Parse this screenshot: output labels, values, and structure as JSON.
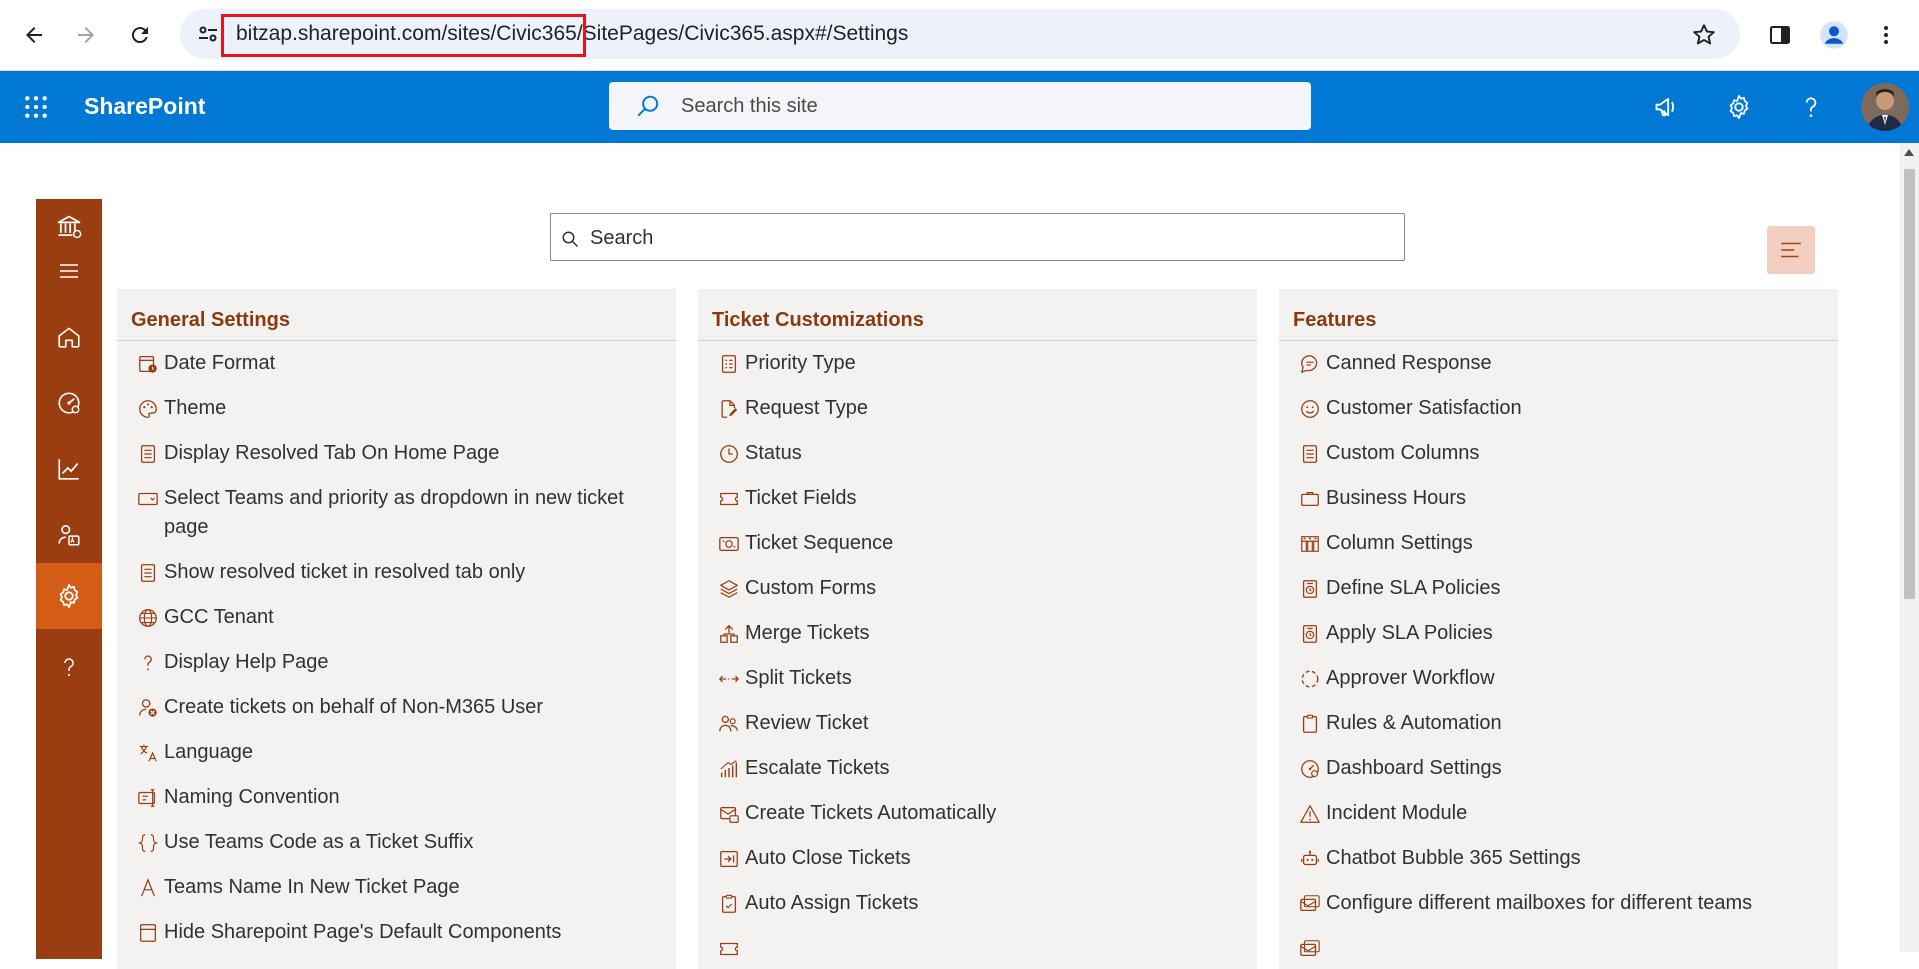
{
  "browser": {
    "url": "bitzap.sharepoint.com/sites/Civic365/SitePages/Civic365.aspx#/Settings"
  },
  "suitebar": {
    "brand": "SharePoint",
    "search_placeholder": "Search this site"
  },
  "main": {
    "search_placeholder": "Search"
  },
  "colors": {
    "accent": "#9a3d10",
    "accent_active": "#d35c17",
    "suitebar": "#0078d4",
    "section_title": "#8a3a0e"
  },
  "rail": {
    "items": [
      {
        "icon": "institution-icon"
      },
      {
        "icon": "hamburger-icon"
      },
      {
        "icon": "home-icon"
      },
      {
        "icon": "dashboard-gauge-icon"
      },
      {
        "icon": "reports-chart-icon"
      },
      {
        "icon": "users-admin-icon"
      },
      {
        "icon": "settings-gear-icon",
        "active": true
      },
      {
        "icon": "help-question-icon"
      }
    ]
  },
  "cards": [
    {
      "title": "General Settings",
      "items": [
        {
          "label": "Date Format",
          "icon": "calendar-clock-icon"
        },
        {
          "label": "Theme",
          "icon": "palette-icon"
        },
        {
          "label": "Display Resolved Tab On Home Page",
          "icon": "document-icon"
        },
        {
          "label": "Select Teams and priority as dropdown in new ticket page",
          "icon": "dropdown-box-icon"
        },
        {
          "label": "Show resolved ticket in resolved tab only",
          "icon": "document-icon"
        },
        {
          "label": "GCC Tenant",
          "icon": "globe-icon"
        },
        {
          "label": "Display Help Page",
          "icon": "question-icon"
        },
        {
          "label": "Create tickets on behalf of Non-M365 User",
          "icon": "user-remove-icon"
        },
        {
          "label": "Language",
          "icon": "translate-icon"
        },
        {
          "label": "Naming Convention",
          "icon": "rename-icon"
        },
        {
          "label": "Use Teams Code as a Ticket Suffix",
          "icon": "braces-icon"
        },
        {
          "label": "Teams Name In New Ticket Page",
          "icon": "text-a-icon"
        },
        {
          "label": "Hide Sharepoint Page's Default Components",
          "icon": "page-layout-icon"
        }
      ]
    },
    {
      "title": "Ticket Customizations",
      "items": [
        {
          "label": "Priority Type",
          "icon": "priority-list-icon"
        },
        {
          "label": "Request Type",
          "icon": "document-edit-icon"
        },
        {
          "label": "Status",
          "icon": "clock-icon"
        },
        {
          "label": "Ticket Fields",
          "icon": "ticket-icon"
        },
        {
          "label": "Ticket Sequence",
          "icon": "number-sequence-icon"
        },
        {
          "label": "Custom Forms",
          "icon": "layers-icon"
        },
        {
          "label": "Merge Tickets",
          "icon": "merge-icon"
        },
        {
          "label": "Split Tickets",
          "icon": "split-arrows-icon"
        },
        {
          "label": "Review Ticket",
          "icon": "people-review-icon"
        },
        {
          "label": "Escalate Tickets",
          "icon": "escalate-chart-icon"
        },
        {
          "label": "Create Tickets Automatically",
          "icon": "mail-ticket-icon"
        },
        {
          "label": "Auto Close Tickets",
          "icon": "auto-close-icon"
        },
        {
          "label": "Auto Assign Tickets",
          "icon": "clipboard-assign-icon"
        },
        {
          "label": "",
          "icon": "ticket-icon"
        }
      ]
    },
    {
      "title": "Features",
      "items": [
        {
          "label": "Canned Response",
          "icon": "chat-bubble-icon"
        },
        {
          "label": "Customer Satisfaction",
          "icon": "smiley-icon"
        },
        {
          "label": "Custom Columns",
          "icon": "document-icon"
        },
        {
          "label": "Business Hours",
          "icon": "briefcase-icon"
        },
        {
          "label": "Column Settings",
          "icon": "column-grid-icon"
        },
        {
          "label": "Define SLA Policies",
          "icon": "sla-policy-icon"
        },
        {
          "label": "Apply SLA Policies",
          "icon": "sla-policy-icon"
        },
        {
          "label": "Approver Workflow",
          "icon": "dashed-circle-icon"
        },
        {
          "label": "Rules & Automation",
          "icon": "clipboard-icon"
        },
        {
          "label": "Dashboard Settings",
          "icon": "gauge-icon"
        },
        {
          "label": "Incident Module",
          "icon": "warning-icon"
        },
        {
          "label": "Chatbot Bubble 365 Settings",
          "icon": "bot-icon"
        },
        {
          "label": "Configure different mailboxes for different teams",
          "icon": "mailbox-icon"
        },
        {
          "label": "",
          "icon": "mailbox-icon"
        }
      ]
    }
  ]
}
